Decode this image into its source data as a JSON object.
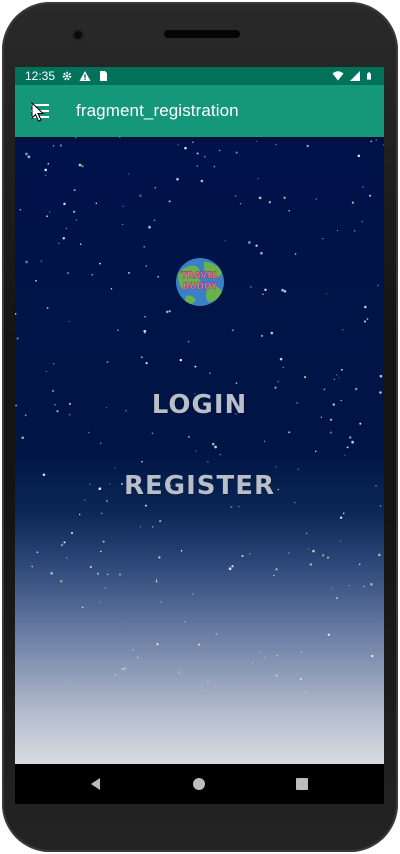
{
  "status_bar": {
    "time": "12:35",
    "icons_left": [
      "gear-icon",
      "warning-icon",
      "sim-card-icon"
    ],
    "icons_right": [
      "wifi-icon",
      "signal-icon",
      "battery-icon"
    ],
    "color": "#00725a"
  },
  "app_bar": {
    "title": "fragment_registration",
    "menu_icon": "hamburger-menu-icon",
    "color": "#159779"
  },
  "main": {
    "logo_text": [
      "TRAVEL",
      "BUDDY"
    ],
    "login_label": "LOGIN",
    "register_label": "REGISTER",
    "button_text_color": "#b8bfc8",
    "background_top": "#00124a",
    "background_bottom": "#d8dbe1"
  },
  "nav_bar": {
    "buttons": [
      "back-icon",
      "home-icon",
      "recents-icon"
    ]
  }
}
